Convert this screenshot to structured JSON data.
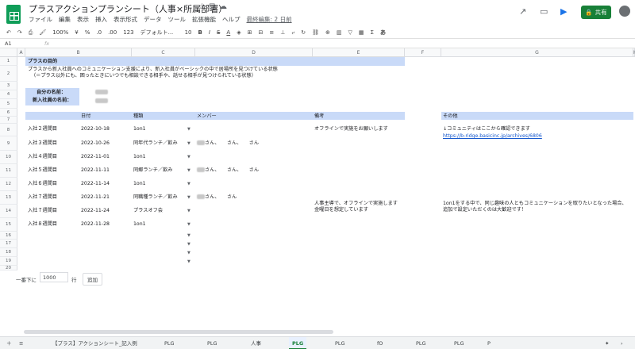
{
  "doc": {
    "title": "プラスアクションプランシート（人事×所属部署）",
    "last_edit": "最終編集: 2 日前",
    "share_label": "共有"
  },
  "menus": [
    "ファイル",
    "編集",
    "表示",
    "挿入",
    "表示形式",
    "データ",
    "ツール",
    "拡張機能",
    "ヘルプ"
  ],
  "toolbar": {
    "zoom": "100%",
    "currency": "¥",
    "percent": "%",
    ".0": ".0",
    ".00": ".00",
    "fmt": "123",
    "font": "デフォルト...",
    "size": "10",
    "bold": "B",
    "italic": "I",
    "strike": "S",
    "underline": "A",
    "ime": "あ"
  },
  "formula": {
    "cell_ref": "A1",
    "fx": "fx"
  },
  "columns": [
    "A",
    "B",
    "C",
    "D",
    "E",
    "F",
    "G",
    "H"
  ],
  "rows": [
    "1",
    "2",
    "3",
    "4",
    "5",
    "6",
    "7",
    "8",
    "9",
    "10",
    "11",
    "12",
    "13",
    "14",
    "15",
    "16",
    "17",
    "18",
    "19",
    "20"
  ],
  "sheet": {
    "purpose_title": "プラスの目的",
    "purpose_line1": "プラスから新入社員へのコミュニケーション支援により、新入社員がベーシックの中で居場所を見つけている状態",
    "purpose_line2": "（＝プラス以外にも、困ったときにいつでも相談できる相手や、話せる相手が見つけられている状態）",
    "self_name_label": "自分の名前：",
    "newbie_name_label": "新入社員の名前：",
    "headers": {
      "date": "日付",
      "type": "種類",
      "member": "メンバー",
      "note": "備考",
      "other": "その他"
    },
    "entries": [
      {
        "week": "入社２週間目",
        "date": "2022-10-18",
        "type": "1on1",
        "member": "",
        "note": "オフラインで実施をお願いします"
      },
      {
        "week": "入社３週間目",
        "date": "2022-10-26",
        "type": "同年代ランチ／飲み",
        "member": "さん、　　さん、　　さん",
        "note": ""
      },
      {
        "week": "入社４週間目",
        "date": "2022-11-01",
        "type": "1on1",
        "member": "",
        "note": ""
      },
      {
        "week": "入社５週間目",
        "date": "2022-11-11",
        "type": "同郷ランチ／飲み",
        "member": "さん、　　さん、　　さん",
        "note": ""
      },
      {
        "week": "入社６週間目",
        "date": "2022-11-14",
        "type": "1on1",
        "member": "",
        "note": ""
      },
      {
        "week": "入社７週間目",
        "date": "2022-11-21",
        "type": "同職種ランチ／飲み",
        "member": "さん、　　さん",
        "note": ""
      },
      {
        "week": "入社７週間目",
        "date": "2022-11-24",
        "type": "プラスオフ会",
        "member": "",
        "note": ""
      },
      {
        "week": "入社８週間目",
        "date": "2022-11-28",
        "type": "1on1",
        "member": "",
        "note": ""
      }
    ],
    "note_row_offline": "人事主導で、オフラインで実施します",
    "note_row_offline2": "金曜日を想定しています",
    "other_line1": "↓コミュニティはここから確認できます",
    "other_link": "https://b-ridge.basicinc.jp/archives/6806",
    "other_note1": "1on1をする中で、同じ趣味の人ともコミュニケーションを取りたいとなった場合、",
    "other_note2": "追加で設定いただくのは大歓迎です！"
  },
  "add_rows": {
    "label": "一番下に",
    "value": "1000",
    "unit": "行",
    "button": "追加"
  },
  "tabs": [
    "【プラス】アクションシート_記入例",
    "PLG",
    "PLG",
    "人事",
    "PLG",
    "PLG",
    "fO",
    "PLG",
    "PLG",
    "P"
  ],
  "active_tab_index": 4
}
